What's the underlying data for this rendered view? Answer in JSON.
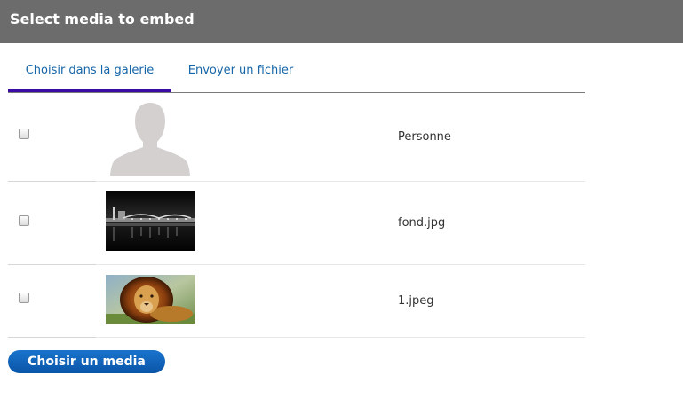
{
  "dialog": {
    "title": "Select media to embed"
  },
  "tabs": [
    {
      "label": "Choisir dans la galerie",
      "active": true
    },
    {
      "label": "Envoyer un fichier",
      "active": false
    }
  ],
  "media": [
    {
      "name": "Personne",
      "checked": false,
      "thumbnail": "person-silhouette"
    },
    {
      "name": "fond.jpg",
      "checked": false,
      "thumbnail": "night-bridge-photo"
    },
    {
      "name": "1.jpeg",
      "checked": false,
      "thumbnail": "lion-photo"
    }
  ],
  "actions": {
    "submit_label": "Choisir un media"
  },
  "colors": {
    "header_bg": "#6c6c6c",
    "tab_text": "#1565a8",
    "tab_active_underline": "#3a0ca3",
    "button_bg": "#0a5eb5"
  }
}
